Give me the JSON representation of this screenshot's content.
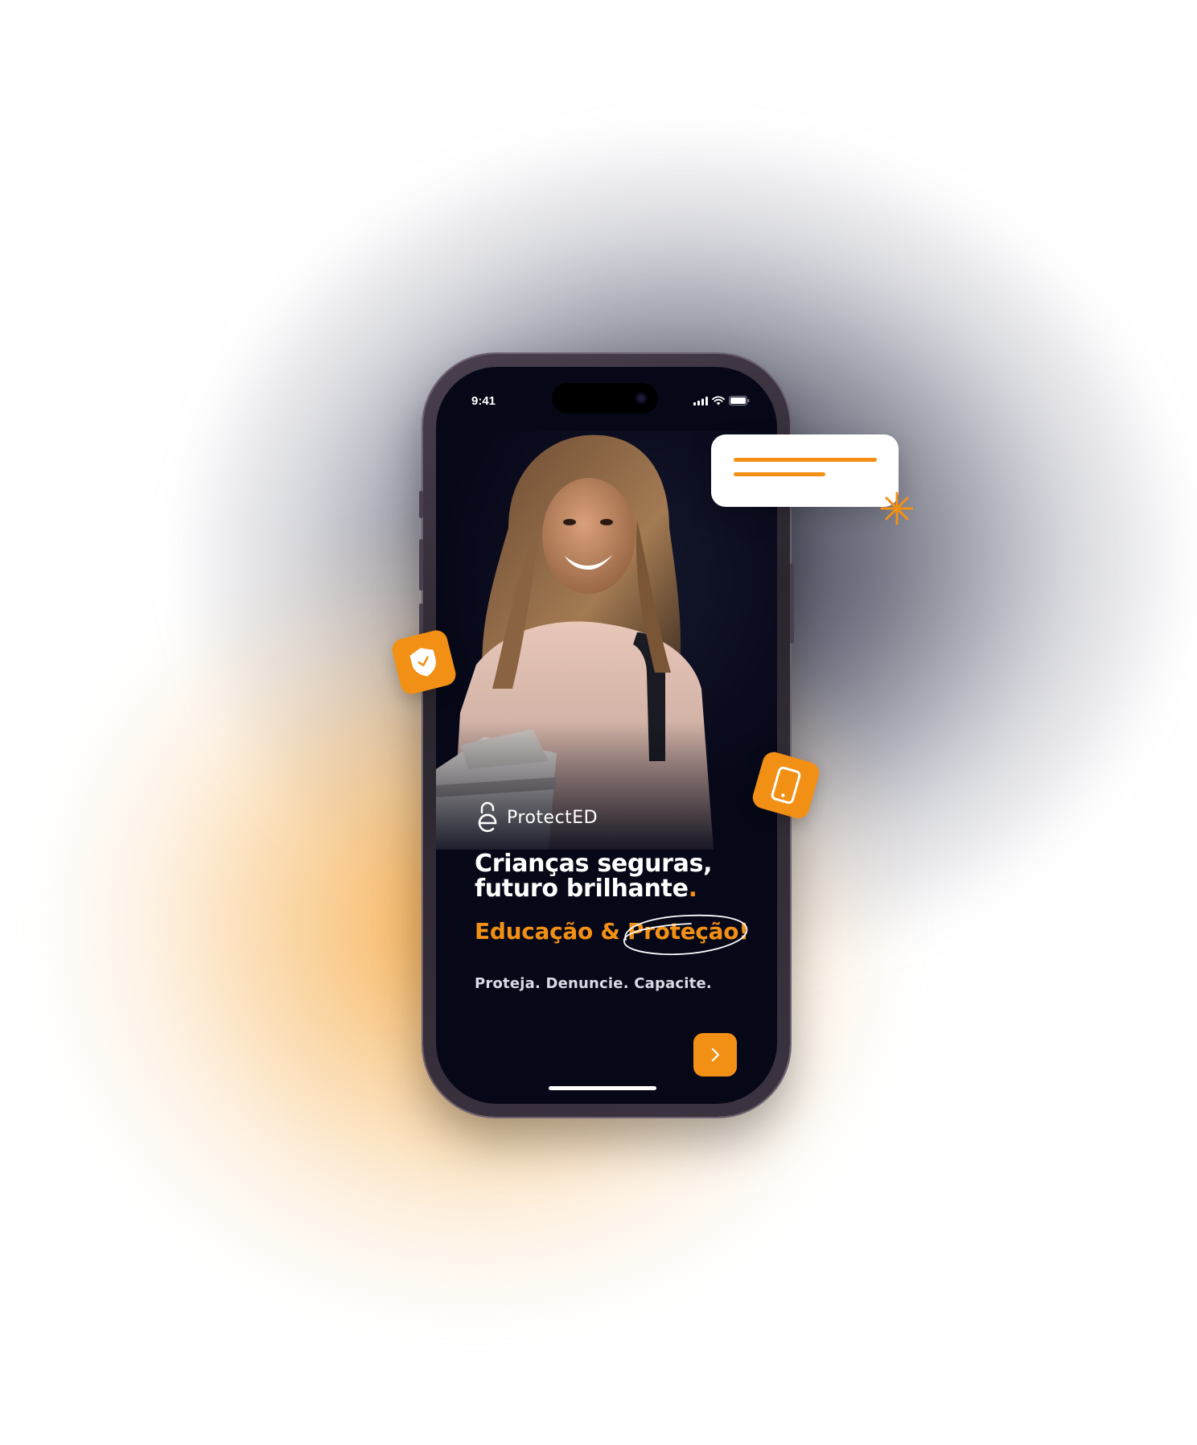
{
  "status_bar": {
    "time": "9:41"
  },
  "app": {
    "brand_name": "ProtectED",
    "headline_line1": "Crianças seguras,",
    "headline_line2": "futuro brilhante",
    "headline_dot": ".",
    "subhead": "Educação & Proteção!",
    "tagline": "Proteja. Denuncie. Capacite."
  },
  "icons": {
    "next": "chevron-right-icon",
    "shield": "shield-check-icon",
    "device": "smartphone-icon",
    "sparkle": "sparkle-icon",
    "logo": "lock-e-logo-icon"
  },
  "colors": {
    "accent": "#F29015",
    "screen_bg": "#060818",
    "text_primary": "#FFFFFF"
  }
}
